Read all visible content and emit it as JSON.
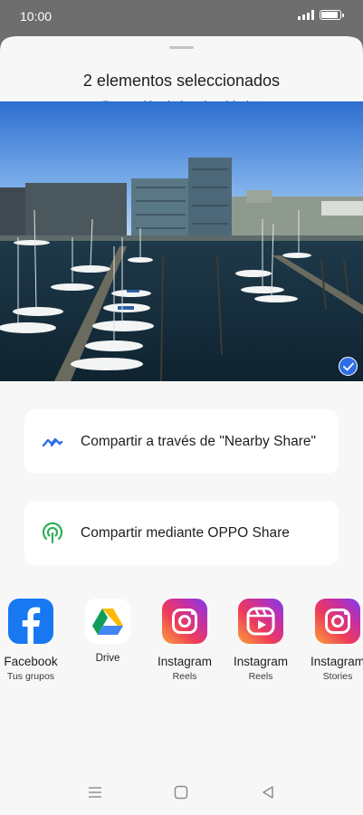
{
  "status_bar": {
    "time": "10:00"
  },
  "sheet": {
    "title": "2 elementos seleccionados",
    "privacy_link": "Protección de la privacidad"
  },
  "photo": {
    "selected": true,
    "icon": "checkmark-icon"
  },
  "share_options": [
    {
      "label": "Compartir a través de \"Nearby Share\"",
      "icon": "nearby-share-icon",
      "color": "#2f6ee8"
    },
    {
      "label": "Compartir mediante OPPO Share",
      "icon": "oppo-share-icon",
      "color": "#2fae5b"
    }
  ],
  "apps": [
    {
      "name": "Facebook",
      "sub": "Tus grupos",
      "icon": "facebook-icon",
      "color": "#1778f2"
    },
    {
      "name": "Drive",
      "sub": "",
      "icon": "google-drive-icon"
    },
    {
      "name": "Instagram",
      "sub": "Reels",
      "icon": "instagram-icon"
    },
    {
      "name": "Instagram",
      "sub": "Reels",
      "icon": "instagram-reels-icon"
    },
    {
      "name": "Instagram",
      "sub": "Stories",
      "icon": "instagram-icon"
    }
  ],
  "nav": {
    "items": [
      "menu-icon",
      "home-icon",
      "back-icon"
    ]
  }
}
